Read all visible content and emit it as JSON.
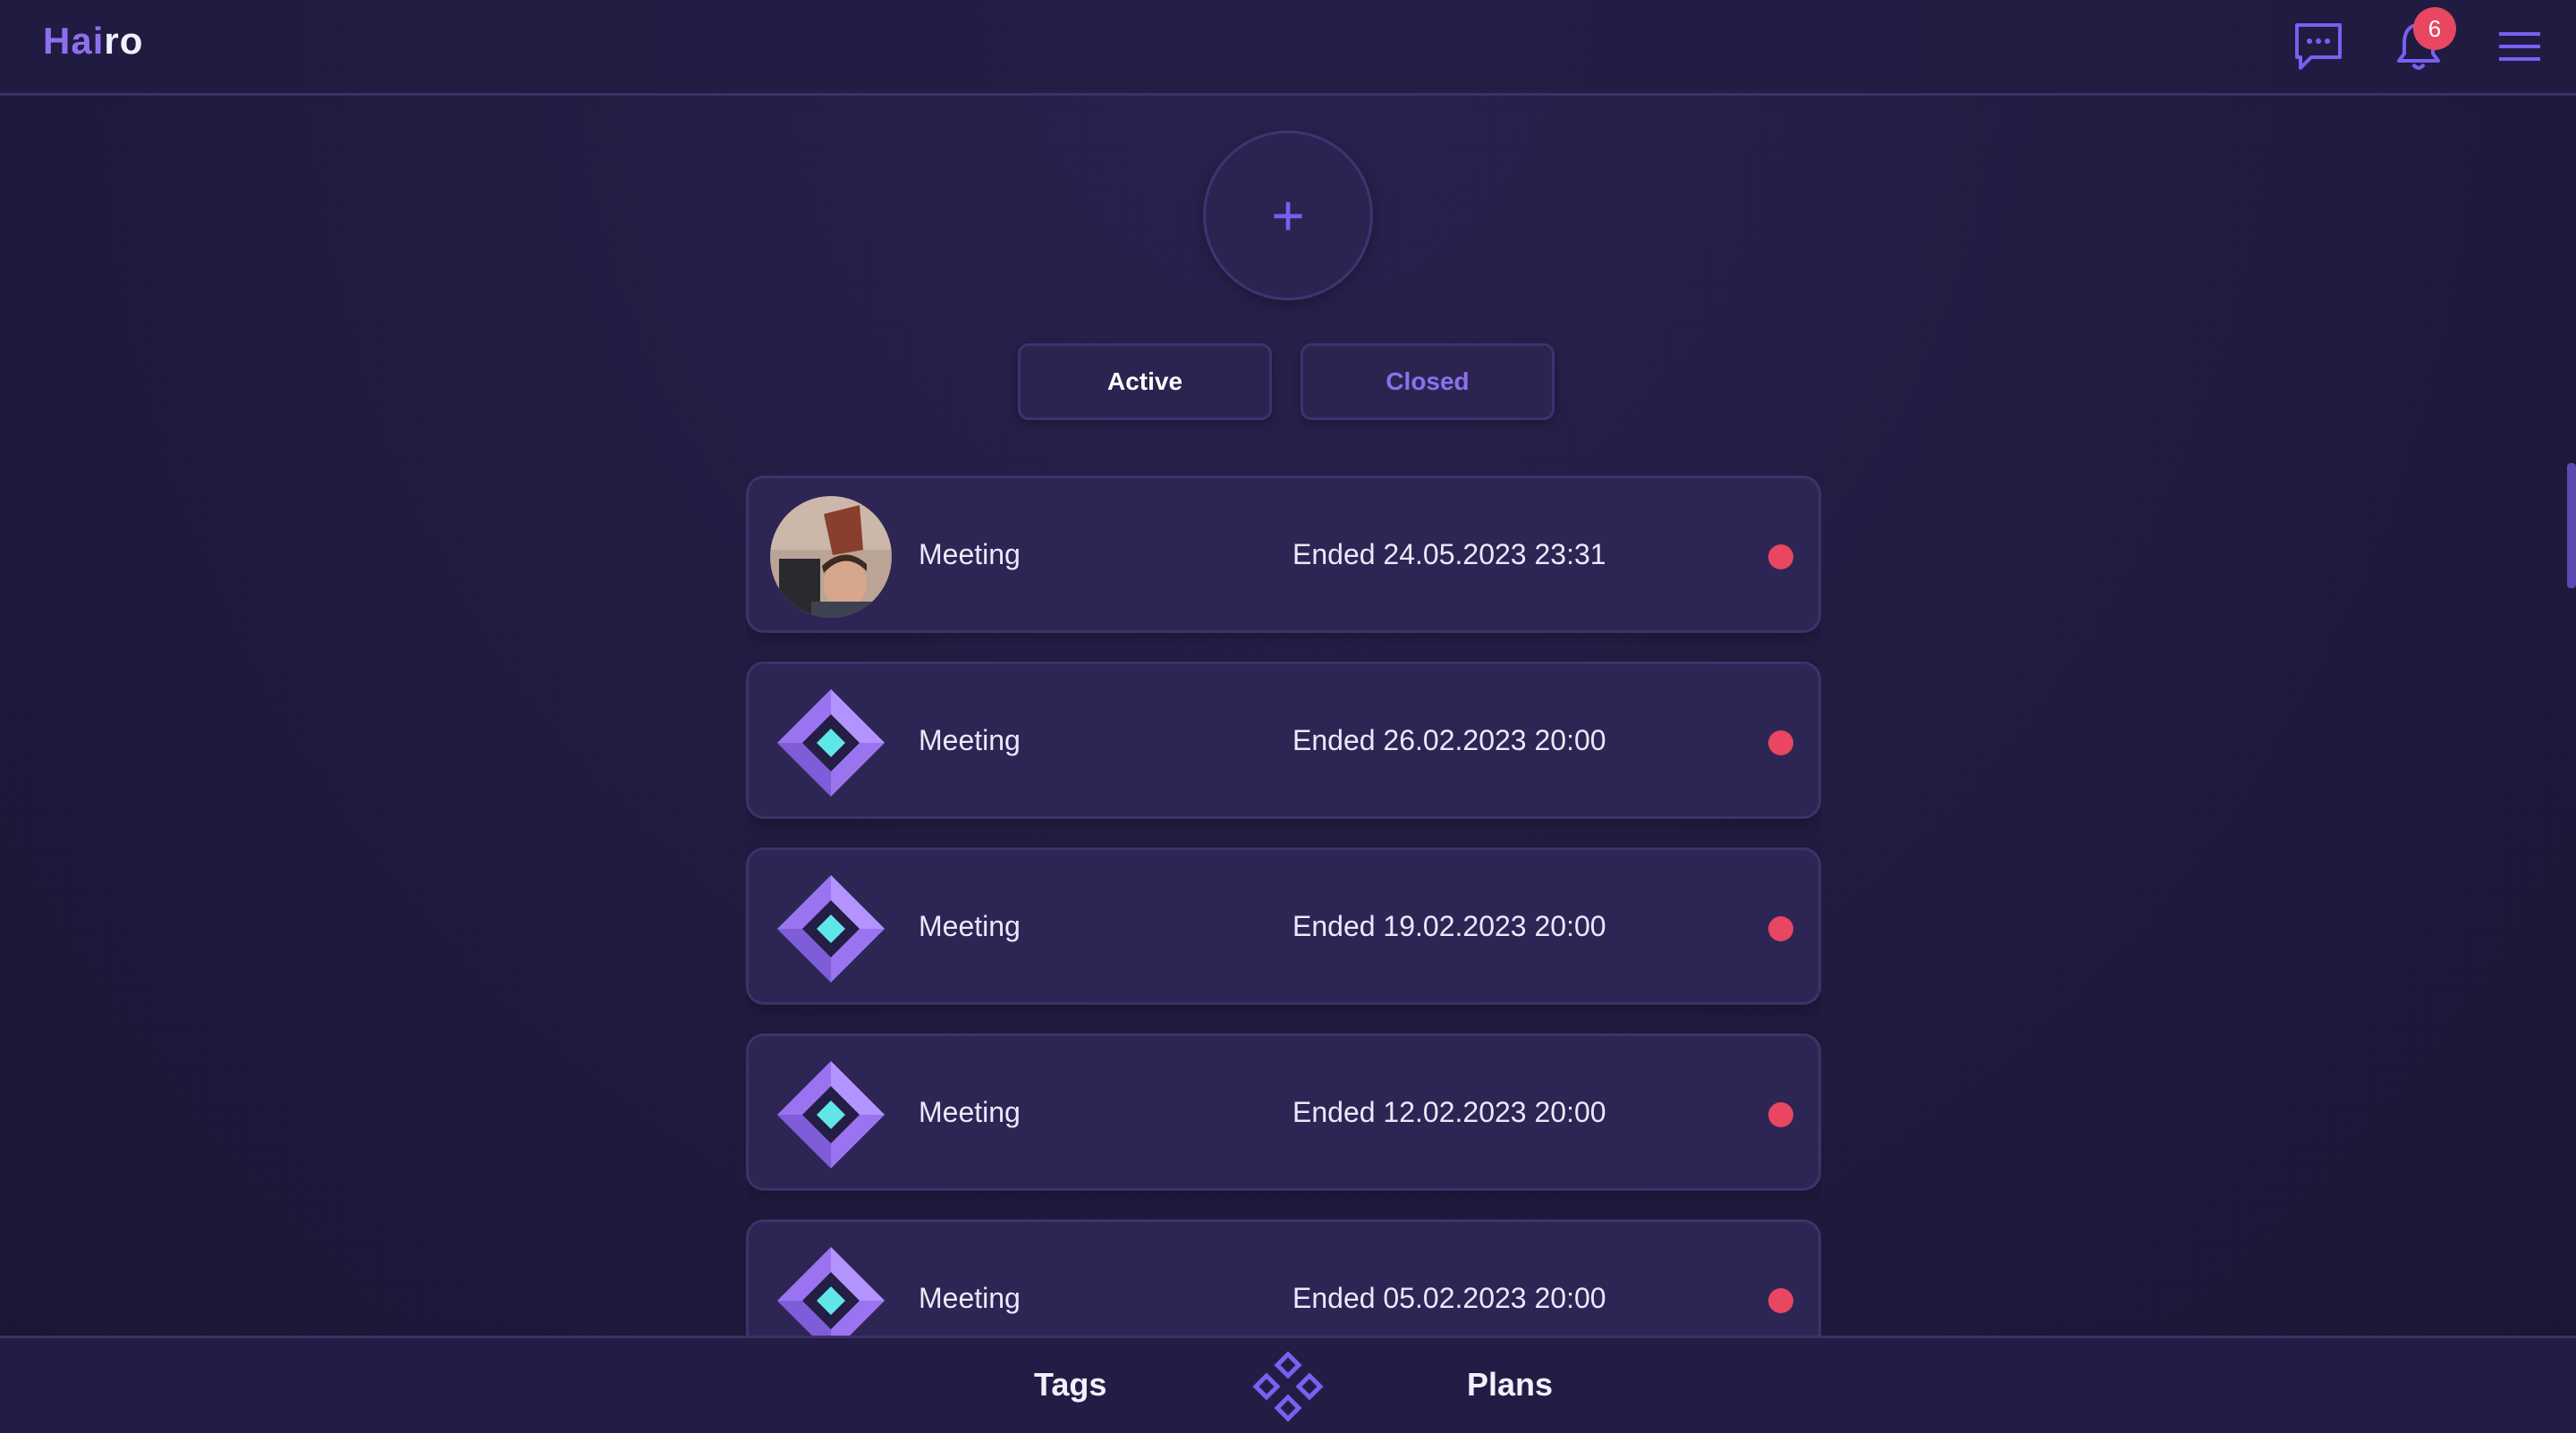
{
  "header": {
    "logo_part1": "Hai",
    "logo_part2": "ro",
    "notification_count": "6",
    "icons": [
      "chat-icon",
      "bell-icon",
      "menu-icon"
    ]
  },
  "add_button": {
    "icon": "plus-icon",
    "symbol": "+"
  },
  "tabs": [
    {
      "label": "Active",
      "selected": true
    },
    {
      "label": "Closed",
      "selected": false
    }
  ],
  "meetings": [
    {
      "title": "Meeting",
      "status": "Ended 24.05.2023 23:31",
      "icon": "user-avatar"
    },
    {
      "title": "Meeting",
      "status": "Ended 26.02.2023 20:00",
      "icon": "diamond-icon"
    },
    {
      "title": "Meeting",
      "status": "Ended 19.02.2023 20:00",
      "icon": "diamond-icon"
    },
    {
      "title": "Meeting",
      "status": "Ended 12.02.2023 20:00",
      "icon": "diamond-icon"
    },
    {
      "title": "Meeting",
      "status": "Ended 05.02.2023 20:00",
      "icon": "diamond-icon"
    }
  ],
  "bottom_nav": {
    "left_label": "Tags",
    "center_icon": "hairo-logo-icon",
    "right_label": "Plans"
  },
  "colors": {
    "accent": "#8e6ff0",
    "status_dot": "#e84661",
    "background": "#221c42",
    "card": "#2d2654"
  }
}
